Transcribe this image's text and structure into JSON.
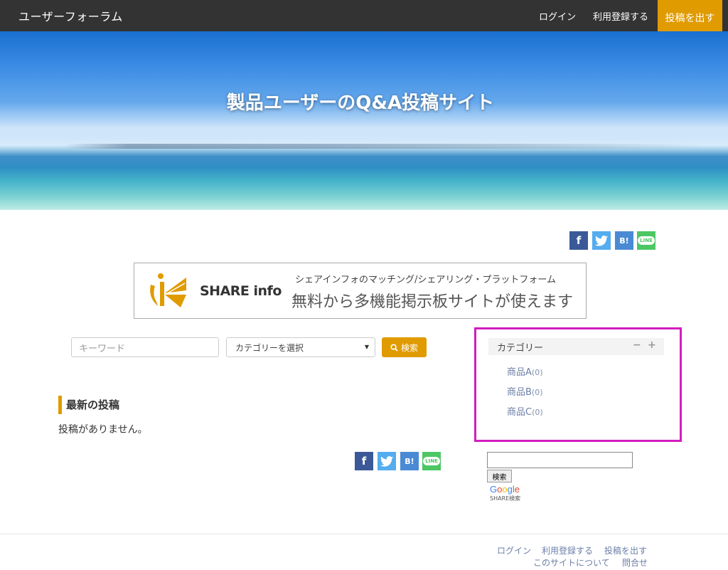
{
  "header": {
    "site_title": "ユーザーフォーラム",
    "nav_login": "ログイン",
    "nav_register": "利用登録する",
    "post_button": "投稿を出す"
  },
  "hero": {
    "title": "製品ユーザーのQ&A投稿サイト"
  },
  "share": {
    "facebook": "f",
    "twitter": "t",
    "hatena": "B!",
    "line": "LINE"
  },
  "banner": {
    "brand": "SHARE info",
    "subtitle": "シェアインフォのマッチング/シェアリング・プラットフォーム",
    "main": "無料から多機能掲示板サイトが使えます"
  },
  "search": {
    "keyword_placeholder": "キーワード",
    "category_value": "カテゴリーを選択",
    "button_label": "検索"
  },
  "latest": {
    "title": "最新の投稿",
    "empty": "投稿がありません。"
  },
  "category_widget": {
    "title": "カテゴリー",
    "items": [
      {
        "label": "商品A",
        "count": "(0)"
      },
      {
        "label": "商品B",
        "count": "(0)"
      },
      {
        "label": "商品C",
        "count": "(0)"
      }
    ]
  },
  "google_search": {
    "button_label": "検索",
    "logo": "Google",
    "sub": "SHARE検索"
  },
  "footer": {
    "login": "ログイン",
    "register": "利用登録する",
    "post": "投稿を出す",
    "about": "このサイトについて",
    "contact": "問合せ"
  },
  "colors": {
    "accent": "#e09b00",
    "topbar": "#333333",
    "highlight_frame": "#d21dbf",
    "link": "#6b7fa8"
  }
}
